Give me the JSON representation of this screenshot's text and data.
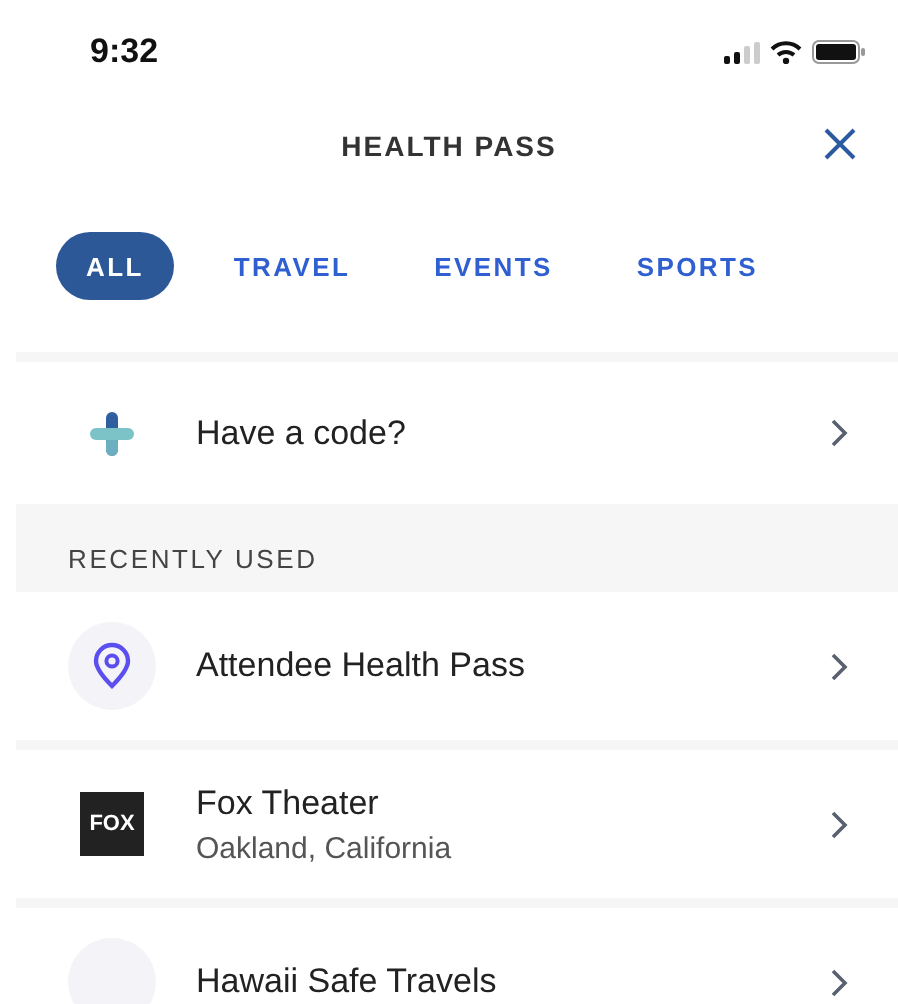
{
  "status_bar": {
    "time": "9:32"
  },
  "header": {
    "title": "HEALTH PASS"
  },
  "tabs": [
    {
      "label": "ALL",
      "selected": true
    },
    {
      "label": "TRAVEL",
      "selected": false
    },
    {
      "label": "EVENTS",
      "selected": false
    },
    {
      "label": "SPORTS",
      "selected": false
    }
  ],
  "code_row": {
    "label": "Have a code?"
  },
  "section": {
    "title": "RECENTLY USED"
  },
  "items": [
    {
      "kind": "pin",
      "title": "Attendee Health Pass"
    },
    {
      "kind": "logo",
      "title": "Fox Theater",
      "subtitle": "Oakland, California",
      "logo_text": "FOX"
    },
    {
      "kind": "circle",
      "title": "Hawaii Safe Travels"
    }
  ]
}
